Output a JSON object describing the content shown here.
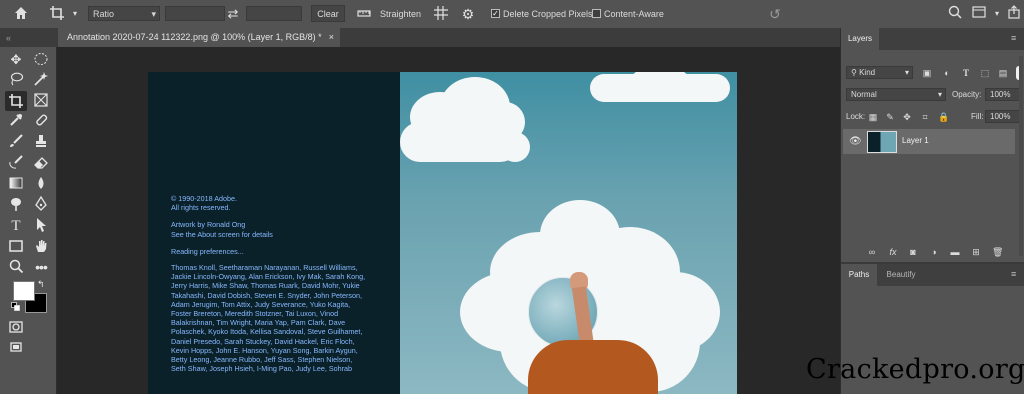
{
  "options_bar": {
    "ratio_label": "Ratio",
    "clear_label": "Clear",
    "straighten_label": "Straighten",
    "delete_cropped_label": "Delete Cropped Pixels",
    "delete_cropped_checked": true,
    "content_aware_label": "Content-Aware",
    "content_aware_checked": false
  },
  "document_tab": {
    "title": "Annotation 2020-07-24 112322.png @ 100% (Layer 1, RGB/8) *",
    "close": "×"
  },
  "splash": {
    "copyright": "© 1990-2018 Adobe.",
    "rights": "All rights reserved.",
    "artwork": "Artwork by Ronald Ong",
    "about": "See the About screen for details",
    "reading": "Reading preferences...",
    "credits": [
      "Thomas Knoll, Seetharaman Narayanan, Russell Williams,",
      "Jackie Lincoln-Owyang, Alan Erickson, Ivy Mak, Sarah Kong,",
      "Jerry Harris, Mike Shaw, Thomas Ruark, David Mohr, Yukie",
      "Takahashi, David Dobish, Steven E. Snyder, John Peterson,",
      "Adam Jerugim, Tom Attix, Judy Severance, Yuko Kagita,",
      "Foster Brereton, Meredith Stotzner, Tai Luxon, Vinod",
      "Balakrishnan, Tim Wright, Maria Yap, Pam Clark, Dave",
      "Polaschek, Kyoko Itoda, Kellisa Sandoval, Steve Guilhamet,",
      "Daniel Presedo, Sarah Stuckey, David Hackel, Eric Floch,",
      "Kevin Hopps, John E. Hanson, Yuyan Song, Barkin Aygun,",
      "Betty Leong, Jeanne Rubbo, Jeff Sass, Stephen Nielson,",
      "Seth Shaw, Joseph Hsieh, I-Ming Pao, Judy Lee, Sohrab"
    ]
  },
  "layers_panel": {
    "tab_label": "Layers",
    "kind_label": "Kind",
    "blend_mode": "Normal",
    "opacity_label": "Opacity:",
    "opacity_value": "100%",
    "lock_label": "Lock:",
    "fill_label": "Fill:",
    "fill_value": "100%",
    "layer_name": "Layer 1"
  },
  "paths_panel": {
    "tab_paths": "Paths",
    "tab_beautify": "Beautify"
  },
  "watermark": "Crackedpro.org",
  "colors": {
    "ui_panel": "#535353",
    "canvas_bg": "#282828",
    "splash_text": "#86b8ff",
    "splash_bg": "#0b2129"
  }
}
